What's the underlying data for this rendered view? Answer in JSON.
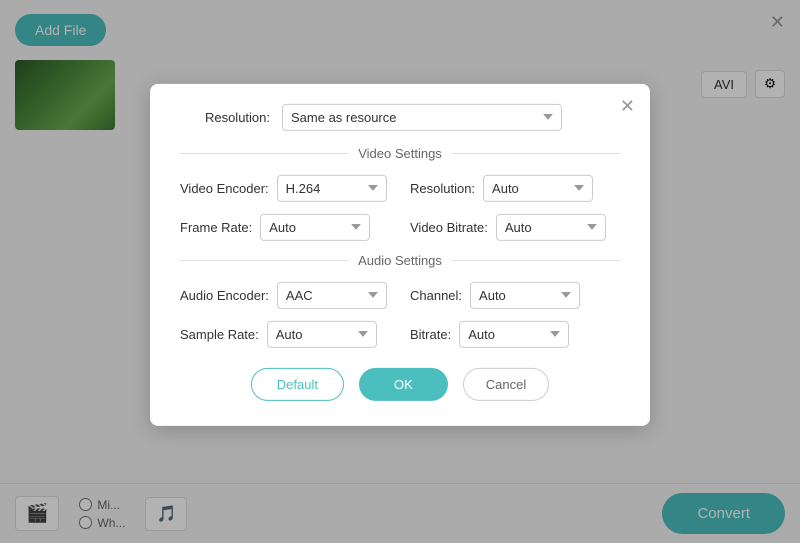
{
  "app": {
    "add_file_label": "Add File",
    "convert_label": "Convert"
  },
  "format_badge": "AVI",
  "resolution_row": {
    "label": "Resolution:",
    "value": "Same as resource"
  },
  "video_settings": {
    "section_title": "Video Settings",
    "encoder_label": "Video Encoder:",
    "encoder_value": "H.264",
    "resolution_label": "Resolution:",
    "resolution_value": "Auto",
    "framerate_label": "Frame Rate:",
    "framerate_value": "Auto",
    "bitrate_label": "Video Bitrate:",
    "bitrate_value": "Auto"
  },
  "audio_settings": {
    "section_title": "Audio Settings",
    "encoder_label": "Audio Encoder:",
    "encoder_value": "AAC",
    "channel_label": "Channel:",
    "channel_value": "Auto",
    "samplerate_label": "Sample Rate:",
    "samplerate_value": "Auto",
    "bitrate_label": "Bitrate:",
    "bitrate_value": "Auto"
  },
  "actions": {
    "default_label": "Default",
    "ok_label": "OK",
    "cancel_label": "Cancel"
  },
  "radio": {
    "option1": "Mi...",
    "option2": "Wh..."
  }
}
